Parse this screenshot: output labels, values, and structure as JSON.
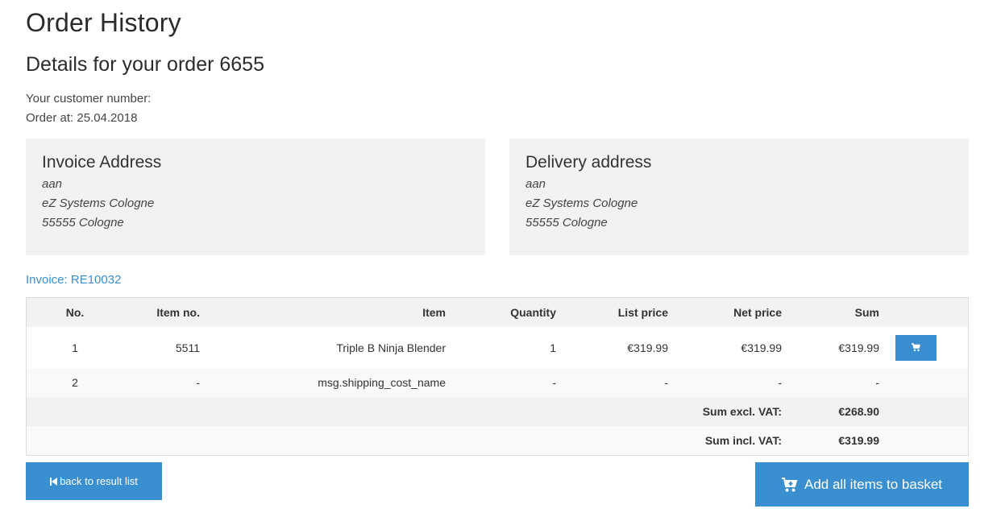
{
  "page": {
    "title": "Order History",
    "order_heading": "Details for your order 6655",
    "customer_number_label": "Your customer number:",
    "order_date": "Order at: 25.04.2018"
  },
  "invoice_address": {
    "title": "Invoice Address",
    "lines": [
      "aan",
      "eZ Systems Cologne",
      "55555 Cologne"
    ]
  },
  "delivery_address": {
    "title": "Delivery address",
    "lines": [
      "aan",
      "eZ Systems Cologne",
      "55555 Cologne"
    ]
  },
  "invoice_link": "Invoice: RE10032",
  "table": {
    "headers": {
      "no": "No.",
      "item_no": "Item no.",
      "item": "Item",
      "quantity": "Quantity",
      "list_price": "List price",
      "net_price": "Net price",
      "sum": "Sum"
    },
    "rows": [
      {
        "no": "1",
        "item_no": "5511",
        "item": "Triple B Ninja Blender",
        "quantity": "1",
        "list_price": "€319.99",
        "net_price": "€319.99",
        "sum": "€319.99"
      },
      {
        "no": "2",
        "item_no": "-",
        "item": "msg.shipping_cost_name",
        "quantity": "-",
        "list_price": "-",
        "net_price": "-",
        "sum": "-"
      }
    ],
    "sum_excl_label": "Sum excl. VAT:",
    "sum_excl_value": "€268.90",
    "sum_incl_label": "Sum incl. VAT:",
    "sum_incl_value": "€319.99"
  },
  "buttons": {
    "back": "back to result list",
    "add_all": "Add all items to basket"
  },
  "icons": {
    "row_cart": "cart-icon",
    "back": "step-backward-icon",
    "add_all": "cart-plus-icon"
  },
  "colors": {
    "accent": "#3a8fd0",
    "box_bg": "#f2f2f2"
  }
}
